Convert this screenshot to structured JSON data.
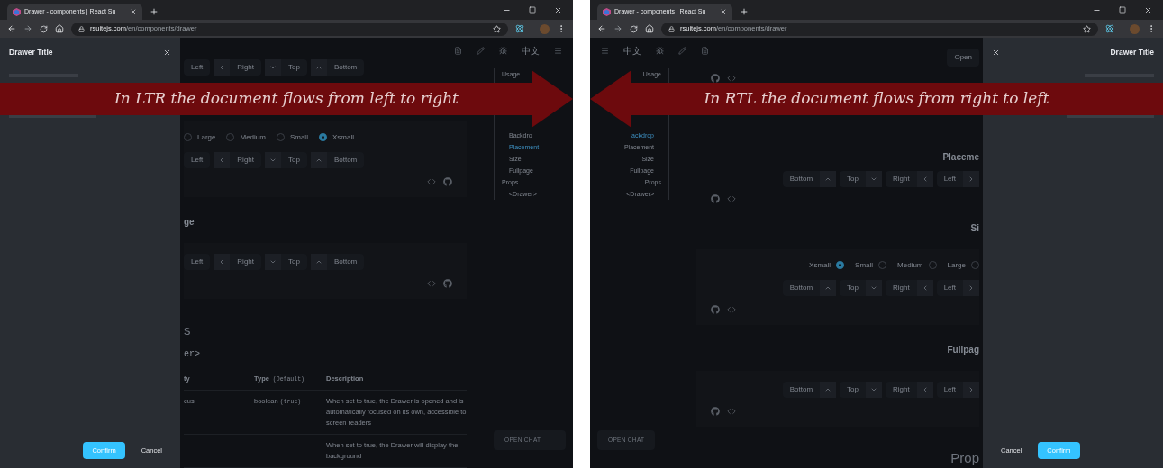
{
  "panels": [
    {
      "tab": {
        "title": "Drawer - components | React Su"
      },
      "address": {
        "host": "rsuitejs.com",
        "path": "/en/components/drawer"
      },
      "drawer": {
        "title": "Drawer Title",
        "buttons": [
          {
            "label": "Confirm",
            "primary": true
          },
          {
            "label": "Cancel",
            "primary": false
          }
        ]
      },
      "header": {
        "language": "中文"
      },
      "sections": [
        {
          "kind": "buttons",
          "items": [
            {
              "label": "Left",
              "kind": "plain"
            },
            {
              "label": "Right",
              "kind": "left"
            },
            {
              "label": "Top",
              "kind": "down"
            },
            {
              "label": "Bottom",
              "kind": "up"
            }
          ]
        },
        {
          "kind": "spacer"
        },
        {
          "kind": "card",
          "sections": [
            {
              "kind": "radios",
              "items": [
                {
                  "label": "Large",
                  "selected": false
                },
                {
                  "label": "Medium",
                  "selected": false
                },
                {
                  "label": "Small",
                  "selected": false
                },
                {
                  "label": "Xsmall",
                  "selected": true
                }
              ]
            },
            {
              "kind": "buttons",
              "items": [
                {
                  "label": "Left",
                  "kind": "plain"
                },
                {
                  "label": "Right",
                  "kind": "left"
                },
                {
                  "label": "Top",
                  "kind": "down"
                },
                {
                  "label": "Bottom",
                  "kind": "up"
                }
              ]
            },
            {
              "kind": "icons"
            }
          ]
        },
        {
          "kind": "heading",
          "text": "ge"
        },
        {
          "kind": "card",
          "sections": [
            {
              "kind": "buttons",
              "items": [
                {
                  "label": "Left",
                  "kind": "plain"
                },
                {
                  "label": "Right",
                  "kind": "left"
                },
                {
                  "label": "Top",
                  "kind": "down"
                },
                {
                  "label": "Bottom",
                  "kind": "up"
                }
              ]
            },
            {
              "kind": "icons"
            }
          ]
        },
        {
          "kind": "title",
          "text": "s"
        },
        {
          "kind": "code",
          "text": "er>"
        },
        {
          "kind": "table",
          "columns": [
            {
              "label": "ty"
            },
            {
              "label": "Type",
              "note": "(Default)"
            },
            {
              "label": "Description"
            }
          ],
          "rows": [
            {
              "property": "cus",
              "type": "boolean",
              "default": "(true)",
              "description": "When set to true, the Drawer is opened and is automatically focused on its own, accessible to screen readers"
            },
            {
              "description": "When set to true, the Drawer will display the background"
            }
          ]
        }
      ],
      "sidebar": {
        "items": [
          {
            "label": "Usage",
            "selected": false,
            "children": [
              {
                "label": "Backdro",
                "selected": false
              },
              {
                "label": "Placement",
                "selected": true
              },
              {
                "label": "Size",
                "selected": false
              },
              {
                "label": "Fullpage",
                "selected": false
              }
            ]
          },
          {
            "label": "Props",
            "selected": false,
            "children": [
              {
                "label": "<Drawer>",
                "selected": false
              }
            ]
          }
        ],
        "chat_button": "OPEN CHAT"
      },
      "banner": {
        "text": "In LTR the document flows from left to right"
      }
    },
    {
      "tab": {
        "title": "Drawer - components | React Su"
      },
      "address": {
        "host": "rsuitejs.com",
        "path": "/en/components/drawer"
      },
      "drawer": {
        "title": "Drawer Title",
        "buttons": [
          {
            "label": "Cancel",
            "primary": false
          },
          {
            "label": "Confirm",
            "primary": true
          }
        ]
      },
      "header": {
        "language": "中文"
      },
      "sections": [
        {
          "kind": "button",
          "label": "Open"
        },
        {
          "kind": "icons"
        },
        {
          "kind": "spacer"
        },
        {
          "kind": "heading",
          "text": "Placeme"
        },
        {
          "kind": "buttons",
          "items": [
            {
              "label": "Bottom",
              "kind": "up"
            },
            {
              "label": "Top",
              "kind": "down"
            },
            {
              "label": "Right",
              "kind": "left"
            },
            {
              "label": "Left",
              "kind": "right"
            }
          ]
        },
        {
          "kind": "icons"
        },
        {
          "kind": "heading",
          "text": "Si"
        },
        {
          "kind": "card",
          "sections": [
            {
              "kind": "radios",
              "items": [
                {
                  "label": "Xsmall",
                  "selected": true
                },
                {
                  "label": "Small",
                  "selected": false
                },
                {
                  "label": "Medium",
                  "selected": false
                },
                {
                  "label": "Large",
                  "selected": false
                }
              ]
            },
            {
              "kind": "buttons",
              "items": [
                {
                  "label": "Bottom",
                  "kind": "up"
                },
                {
                  "label": "Top",
                  "kind": "down"
                },
                {
                  "label": "Right",
                  "kind": "left"
                },
                {
                  "label": "Left",
                  "kind": "right"
                }
              ]
            },
            {
              "kind": "icons"
            }
          ]
        },
        {
          "kind": "heading",
          "text": "Fullpag"
        },
        {
          "kind": "card",
          "sections": [
            {
              "kind": "buttons",
              "items": [
                {
                  "label": "Bottom",
                  "kind": "up"
                },
                {
                  "label": "Top",
                  "kind": "down"
                },
                {
                  "label": "Right",
                  "kind": "left"
                },
                {
                  "label": "Left",
                  "kind": "right"
                }
              ]
            },
            {
              "kind": "icons"
            }
          ]
        },
        {
          "kind": "title",
          "text": "Prop"
        }
      ],
      "sidebar": {
        "items": [
          {
            "label": "Usage",
            "selected": false,
            "children": [
              {
                "label": "ackdrop",
                "selected": true
              },
              {
                "label": "Placement",
                "selected": false
              },
              {
                "label": "Size",
                "selected": false
              },
              {
                "label": "Fullpage",
                "selected": false
              }
            ]
          },
          {
            "label": "Props",
            "selected": false,
            "children": [
              {
                "label": "<Drawer>",
                "selected": false
              }
            ]
          }
        ],
        "chat_button": "OPEN CHAT"
      },
      "banner": {
        "text": "In RTL the document flows from right to left"
      }
    }
  ]
}
